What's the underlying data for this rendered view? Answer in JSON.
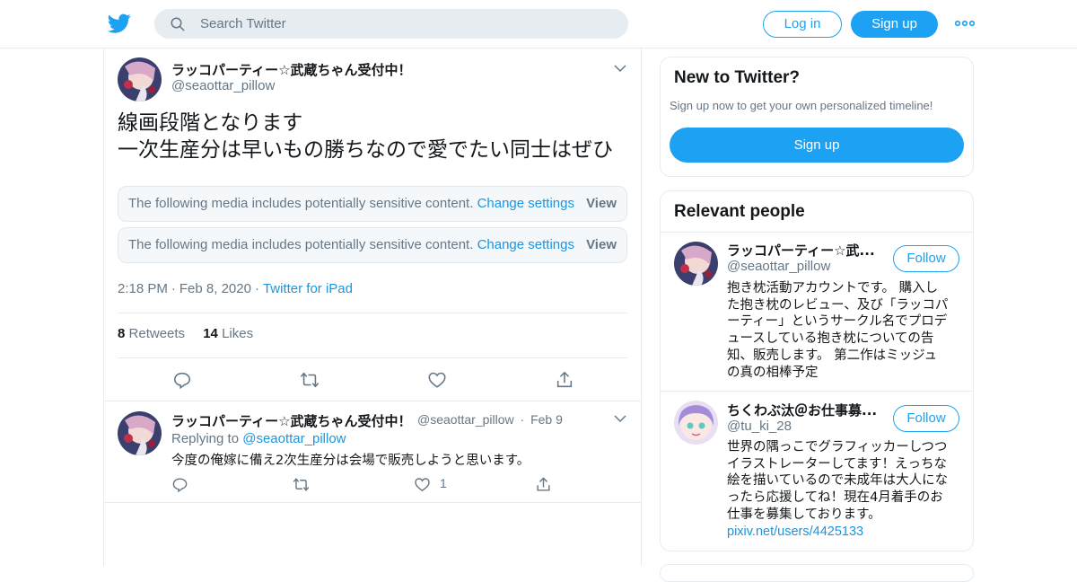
{
  "header": {
    "search_placeholder": "Search Twitter",
    "login_label": "Log in",
    "signup_label": "Sign up",
    "brand_color": "#1da1f2"
  },
  "tweet": {
    "author_name": "ラッコパーティー☆武蔵ちゃん受付中！",
    "author_handle": "@seaottar_pillow",
    "text_line1": "線画段階となります",
    "text_line2": "一次生産分は早いもの勝ちなので愛でたい同士はぜひ",
    "sensitive_notice": "The following media includes potentially sensitive content.",
    "change_settings": "Change settings",
    "view_label": "View",
    "time": "2:18 PM",
    "date": "Feb 8, 2020",
    "source": "Twitter for iPad",
    "retweets_count": "8",
    "retweets_label": "Retweets",
    "likes_count": "14",
    "likes_label": "Likes"
  },
  "reply": {
    "author_name": "ラッコパーティー☆武蔵ちゃん受付中！",
    "author_handle": "@seaottar_pillow",
    "date": "Feb 9",
    "replying_to_label": "Replying to",
    "replying_to_handle": "@seaottar_pillow",
    "text": "今度の俺嫁に備え2次生産分は会場で販売しようと思います。",
    "likes_count": "1"
  },
  "sidebar": {
    "new_to_twitter": {
      "title": "New to Twitter?",
      "subtitle": "Sign up now to get your own personalized timeline!",
      "signup_label": "Sign up"
    },
    "relevant_people": {
      "title": "Relevant people",
      "follow_label": "Follow",
      "people": [
        {
          "name": "ラッコパーティー☆武...",
          "handle": "@seaottar_pillow",
          "bio_lines": [
            "抱き枕活動アカウントです。 購入し",
            "た抱き枕のレビュー、及び「ラッコパ",
            "ーティー」というサークル名でプロデ",
            "ュースしている抱き枕についての告",
            "知、販売します。 第二作はミッジュ",
            "の真の相棒予定"
          ]
        },
        {
          "name": "ちくわぶ汰＠お仕事募...",
          "handle": "@tu_ki_28",
          "bio_lines": [
            "世界の隅っこでグラフィッカーしつつ",
            "イラストレーターしてます！えっちな",
            "絵を描いているので未成年は大人にな",
            "ったら応援してね！現在4月着手のお",
            "仕事を募集しております。"
          ],
          "bio_link": "pixiv.net/users/4425133"
        }
      ]
    }
  }
}
